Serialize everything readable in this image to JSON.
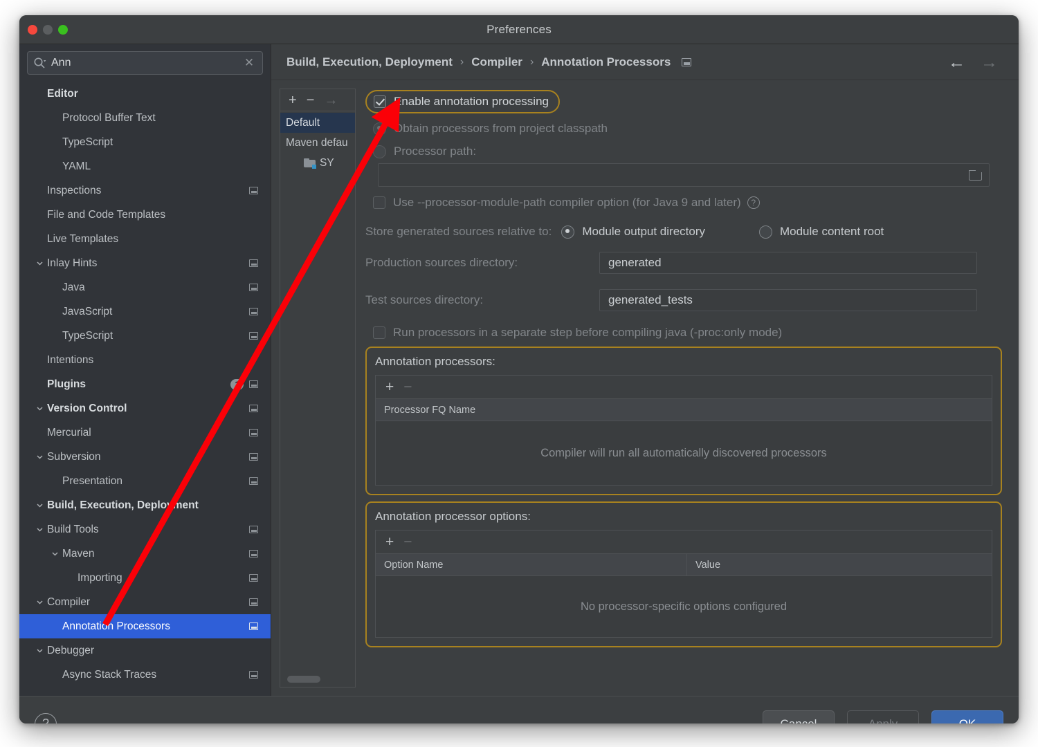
{
  "window": {
    "title": "Preferences",
    "traffic": {
      "close": "close-button",
      "minimize": "minimize-button",
      "maximize": "maximize-button"
    }
  },
  "search": {
    "value": "Ann",
    "placeholder": "",
    "clear_glyph": "✕"
  },
  "sidebar": {
    "items": [
      {
        "label": "Editor",
        "indent": 0,
        "bold": true,
        "chevron": "",
        "config": false,
        "selected": false,
        "badge": ""
      },
      {
        "label": "Protocol Buffer Text",
        "indent": 1,
        "bold": false,
        "chevron": "",
        "config": false,
        "selected": false,
        "badge": ""
      },
      {
        "label": "TypeScript",
        "indent": 1,
        "bold": false,
        "chevron": "",
        "config": false,
        "selected": false,
        "badge": ""
      },
      {
        "label": "YAML",
        "indent": 1,
        "bold": false,
        "chevron": "",
        "config": false,
        "selected": false,
        "badge": ""
      },
      {
        "label": "Inspections",
        "indent": 0,
        "bold": false,
        "chevron": "",
        "config": true,
        "selected": false,
        "badge": ""
      },
      {
        "label": "File and Code Templates",
        "indent": 0,
        "bold": false,
        "chevron": "",
        "config": false,
        "selected": false,
        "badge": ""
      },
      {
        "label": "Live Templates",
        "indent": 0,
        "bold": false,
        "chevron": "",
        "config": false,
        "selected": false,
        "badge": ""
      },
      {
        "label": "Inlay Hints",
        "indent": 0,
        "bold": false,
        "chevron": "v",
        "config": true,
        "selected": false,
        "badge": ""
      },
      {
        "label": "Java",
        "indent": 1,
        "bold": false,
        "chevron": "",
        "config": true,
        "selected": false,
        "badge": ""
      },
      {
        "label": "JavaScript",
        "indent": 1,
        "bold": false,
        "chevron": "",
        "config": true,
        "selected": false,
        "badge": ""
      },
      {
        "label": "TypeScript",
        "indent": 1,
        "bold": false,
        "chevron": "",
        "config": true,
        "selected": false,
        "badge": ""
      },
      {
        "label": "Intentions",
        "indent": 0,
        "bold": false,
        "chevron": "",
        "config": false,
        "selected": false,
        "badge": ""
      },
      {
        "label": "Plugins",
        "indent": 0,
        "bold": true,
        "chevron": "",
        "config": true,
        "selected": false,
        "badge": "1"
      },
      {
        "label": "Version Control",
        "indent": 0,
        "bold": true,
        "chevron": "v",
        "config": true,
        "selected": false,
        "badge": ""
      },
      {
        "label": "Mercurial",
        "indent": 0,
        "bold": false,
        "chevron": "",
        "config": true,
        "selected": false,
        "badge": ""
      },
      {
        "label": "Subversion",
        "indent": 0,
        "bold": false,
        "chevron": "v",
        "config": true,
        "selected": false,
        "badge": ""
      },
      {
        "label": "Presentation",
        "indent": 1,
        "bold": false,
        "chevron": "",
        "config": true,
        "selected": false,
        "badge": ""
      },
      {
        "label": "Build, Execution, Deployment",
        "indent": 0,
        "bold": true,
        "chevron": "v",
        "config": false,
        "selected": false,
        "badge": ""
      },
      {
        "label": "Build Tools",
        "indent": 0,
        "bold": false,
        "chevron": "v",
        "config": true,
        "selected": false,
        "badge": ""
      },
      {
        "label": "Maven",
        "indent": 1,
        "bold": false,
        "chevron": "v",
        "config": true,
        "selected": false,
        "badge": ""
      },
      {
        "label": "Importing",
        "indent": 2,
        "bold": false,
        "chevron": "",
        "config": true,
        "selected": false,
        "badge": ""
      },
      {
        "label": "Compiler",
        "indent": 0,
        "bold": false,
        "chevron": "v",
        "config": true,
        "selected": false,
        "badge": ""
      },
      {
        "label": "Annotation Processors",
        "indent": 1,
        "bold": false,
        "chevron": "",
        "config": true,
        "selected": true,
        "badge": ""
      },
      {
        "label": "Debugger",
        "indent": 0,
        "bold": false,
        "chevron": "v",
        "config": false,
        "selected": false,
        "badge": ""
      },
      {
        "label": "Async Stack Traces",
        "indent": 1,
        "bold": false,
        "chevron": "",
        "config": true,
        "selected": false,
        "badge": ""
      }
    ]
  },
  "breadcrumb": {
    "parts": [
      "Build, Execution, Deployment",
      "Compiler",
      "Annotation Processors"
    ],
    "separator": "›",
    "back_glyph": "←",
    "forward_glyph": "→"
  },
  "profiles": {
    "toolbar": {
      "add": "+",
      "remove": "−",
      "copy": "→"
    },
    "items": [
      {
        "label": "Default",
        "selected": true,
        "folder": false
      },
      {
        "label": "Maven defau",
        "selected": false,
        "folder": false
      },
      {
        "label": "SY",
        "selected": false,
        "folder": true
      }
    ]
  },
  "settings": {
    "enable_annotation_processing": {
      "label": "Enable annotation processing",
      "checked": true,
      "highlighted": true
    },
    "obtain_from_classpath": {
      "label": "Obtain processors from project classpath",
      "selected": true
    },
    "processor_path": {
      "label": "Processor path:",
      "selected": false,
      "value": ""
    },
    "use_processor_module_path": {
      "label": "Use --processor-module-path compiler option (for Java 9 and later)",
      "checked": false,
      "help_glyph": "?"
    },
    "store_relative_label": "Store generated sources relative to:",
    "store_module_output": {
      "label": "Module output directory",
      "selected": true
    },
    "store_module_content_root": {
      "label": "Module content root",
      "selected": false
    },
    "production_sources": {
      "label": "Production sources directory:",
      "value": "generated"
    },
    "test_sources": {
      "label": "Test sources directory:",
      "value": "generated_tests"
    },
    "run_separate_step": {
      "label": "Run processors in a separate step before compiling java (-proc:only mode)",
      "checked": false
    }
  },
  "annotation_processors": {
    "title": "Annotation processors:",
    "toolbar": {
      "add": "+",
      "remove": "−"
    },
    "column": "Processor FQ Name",
    "empty_text": "Compiler will run all automatically discovered processors"
  },
  "annotation_processor_options": {
    "title": "Annotation processor options:",
    "toolbar": {
      "add": "+",
      "remove": "−"
    },
    "columns": [
      "Option Name",
      "Value"
    ],
    "empty_text": "No processor-specific options configured"
  },
  "footer": {
    "help": "?",
    "cancel": "Cancel",
    "apply": "Apply",
    "ok": "OK"
  },
  "colors": {
    "highlight_ring": "#a8821f",
    "annotation_arrow": "#fb0007",
    "selection_blue": "#2f5fd8",
    "ok_button": "#3b69b0"
  }
}
